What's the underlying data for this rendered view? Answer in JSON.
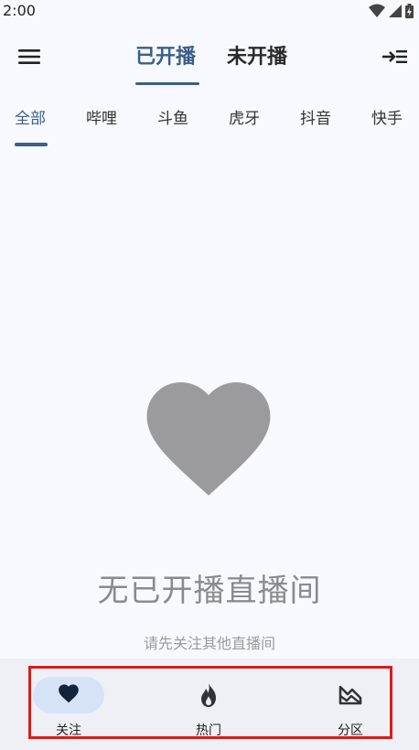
{
  "status_bar": {
    "time": "2:00"
  },
  "top_bar": {
    "tabs": [
      {
        "label": "已开播",
        "active": true
      },
      {
        "label": "未开播",
        "active": false
      }
    ]
  },
  "platform_tabs": [
    "全部",
    "哔哩",
    "斗鱼",
    "虎牙",
    "抖音",
    "快手"
  ],
  "empty_state": {
    "icon": "heart-icon",
    "title": "无已开播直播间",
    "subtitle": "请先关注其他直播间"
  },
  "bottom_nav": {
    "items": [
      {
        "label": "关注",
        "icon": "heart-icon",
        "active": true
      },
      {
        "label": "热门",
        "icon": "fire-icon",
        "active": false
      },
      {
        "label": "分区",
        "icon": "landscape-icon",
        "active": false
      }
    ]
  },
  "colors": {
    "accent": "#3a5f88",
    "highlight": "#d81c1c"
  }
}
